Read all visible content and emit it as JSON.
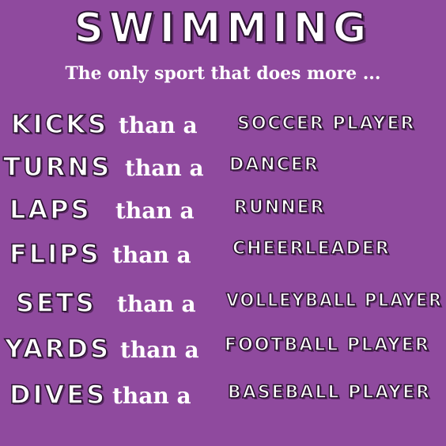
{
  "poster": {
    "title": "SWIMMING",
    "subtitle": "The only sport that does more ...",
    "rows": [
      {
        "action": "KICKS",
        "connector": "than a",
        "role": "SOCCER PLAYER"
      },
      {
        "action": "TURNS",
        "connector": "than a",
        "role": "DANCER"
      },
      {
        "action": "LAPS",
        "connector": "than a",
        "role": "RUNNER"
      },
      {
        "action": "FLIPS",
        "connector": "than a",
        "role": "CHEERLEADER"
      },
      {
        "action": "SETS",
        "connector": "than a",
        "role": "VOLLEYBALL PLAYER"
      },
      {
        "action": "YARDS",
        "connector": "than a",
        "role": "FOOTBALL PLAYER"
      },
      {
        "action": "DIVES",
        "connector": "than a",
        "role": "BASEBALL PLAYER"
      }
    ]
  },
  "colors": {
    "background": "#8f4a9e",
    "text": "#ffffff",
    "outline": "#2a1130"
  }
}
